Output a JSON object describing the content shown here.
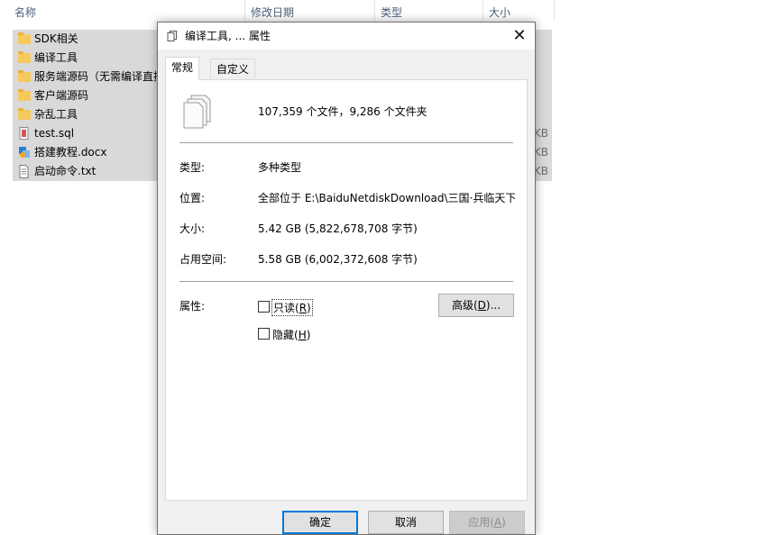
{
  "explorer": {
    "columns": [
      "名称",
      "修改日期",
      "类型",
      "大小"
    ],
    "files": [
      {
        "name": "SDK相关",
        "icon": "folder-icon",
        "size": ""
      },
      {
        "name": "编译工具",
        "icon": "folder-icon",
        "size": ""
      },
      {
        "name": "服务端源码（无需编译直接",
        "icon": "folder-icon",
        "size": ""
      },
      {
        "name": "客户端源码",
        "icon": "folder-icon",
        "size": ""
      },
      {
        "name": "杂乱工具",
        "icon": "folder-icon",
        "size": ""
      },
      {
        "name": "test.sql",
        "icon": "sql-file-icon",
        "size": "KB"
      },
      {
        "name": "搭建教程.docx",
        "icon": "docx-file-icon",
        "size": "KB"
      },
      {
        "name": "启动命令.txt",
        "icon": "txt-file-icon",
        "size": "KB"
      }
    ]
  },
  "dialog": {
    "title": "编译工具, ... 属性",
    "close_symbol": "✕",
    "tabs": [
      "常规",
      "自定义"
    ],
    "summary": "107,359 个文件，9,286 个文件夹",
    "type_label": "类型:",
    "type_value": "多种类型",
    "location_label": "位置:",
    "location_value": "全部位于 E:\\BaiduNetdiskDownload\\三国·兵临天下\\",
    "size_label": "大小:",
    "size_value": "5.42 GB (5,822,678,708 字节)",
    "disk_label": "占用空间:",
    "disk_value": "5.58 GB (6,002,372,608 字节)",
    "attr_label": "属性:",
    "readonly_text": "只读",
    "readonly_key": "R",
    "hidden_text": "隐藏",
    "hidden_key": "H",
    "advanced_text": "高级",
    "advanced_key": "D",
    "advanced_suffix": "...",
    "ok": "确定",
    "cancel": "取消",
    "apply_text": "应用",
    "apply_key": "A"
  }
}
